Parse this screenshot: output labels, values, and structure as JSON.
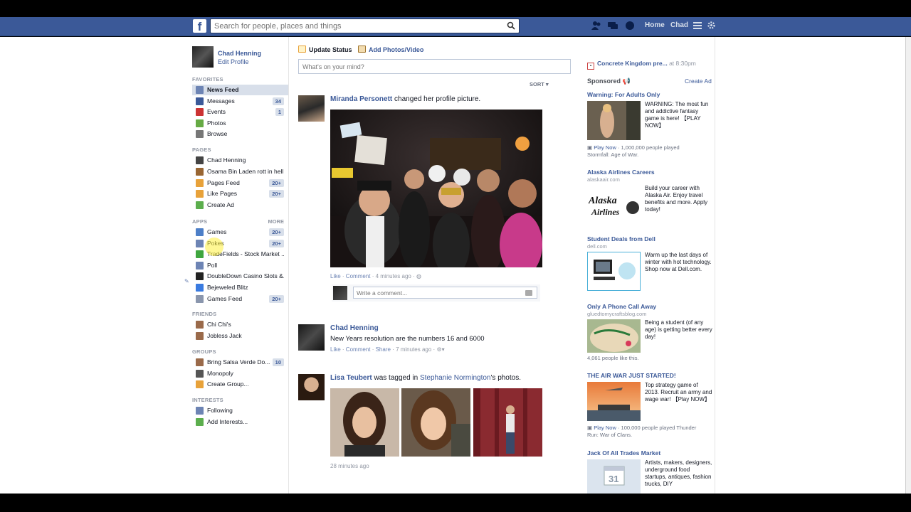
{
  "topbar": {
    "search_placeholder": "Search for people, places and things",
    "home": "Home",
    "user": "Chad"
  },
  "left_nav": {
    "profile_name": "Chad Henning",
    "edit_profile": "Edit Profile",
    "favorites_header": "FAVORITES",
    "favorites": [
      {
        "label": "News Feed",
        "count": "",
        "color": "#6d84b4"
      },
      {
        "label": "Messages",
        "count": "34",
        "color": "#3b5998"
      },
      {
        "label": "Events",
        "count": "1",
        "color": "#cc3333"
      },
      {
        "label": "Photos",
        "count": "",
        "color": "#66aa44"
      },
      {
        "label": "Browse",
        "count": "",
        "color": "#777777"
      }
    ],
    "pages_header": "PAGES",
    "pages": [
      {
        "label": "Chad Henning",
        "count": "",
        "color": "#444444"
      },
      {
        "label": "Osama Bin Laden rott in hell",
        "count": "",
        "color": "#996633"
      },
      {
        "label": "Pages Feed",
        "count": "20+",
        "color": "#e8a23a"
      },
      {
        "label": "Like Pages",
        "count": "20+",
        "color": "#e8a23a"
      },
      {
        "label": "Create Ad",
        "count": "",
        "color": "#5cae4d"
      }
    ],
    "apps_header": "APPS",
    "apps_more": "MORE",
    "apps": [
      {
        "label": "Games",
        "count": "20+",
        "color": "#4d7fc8"
      },
      {
        "label": "Pokes",
        "count": "20+",
        "color": "#6d84b4"
      },
      {
        "label": "TradeFields - Stock Market ...",
        "count": "",
        "color": "#3fa63f"
      },
      {
        "label": "Poll",
        "count": "",
        "color": "#6d84b4"
      },
      {
        "label": "DoubleDown Casino Slots &...",
        "count": "",
        "color": "#222222"
      },
      {
        "label": "Bejeweled Blitz",
        "count": "",
        "color": "#3a7be0"
      },
      {
        "label": "Games Feed",
        "count": "20+",
        "color": "#8a96ad"
      }
    ],
    "friends_header": "FRIENDS",
    "friends": [
      {
        "label": "Chi Chi's",
        "count": "",
        "color": "#9a6a4a"
      },
      {
        "label": "Jobless Jack",
        "count": "",
        "color": "#9a6a4a"
      }
    ],
    "groups_header": "GROUPS",
    "groups": [
      {
        "label": "Bring Salsa Verde Do...",
        "count": "10",
        "color": "#9a6a4a"
      },
      {
        "label": "Monopoly",
        "count": "",
        "color": "#555555"
      },
      {
        "label": "Create Group...",
        "count": "",
        "color": "#e8a23a"
      }
    ],
    "interests_header": "INTERESTS",
    "interests": [
      {
        "label": "Following",
        "count": "",
        "color": "#6d84b4"
      },
      {
        "label": "Add Interests...",
        "count": "",
        "color": "#5cae4d"
      }
    ]
  },
  "composer": {
    "update_status": "Update Status",
    "add_photos": "Add Photos/Video",
    "placeholder": "What's on your mind?",
    "sort": "SORT"
  },
  "feed": {
    "story1": {
      "name": "Miranda Personett",
      "action": " changed her profile picture.",
      "meta_like": "Like",
      "meta_comment": "Comment",
      "meta_time": "4 minutes ago",
      "comment_placeholder": "Write a comment..."
    },
    "story2": {
      "name": "Chad Henning",
      "body": "New Years resolution are the numbers 16 and 6000",
      "meta_like": "Like",
      "meta_comment": "Comment",
      "meta_share": "Share",
      "meta_time": "7 minutes ago"
    },
    "story3": {
      "name": "Lisa Teubert",
      "action": " was tagged in ",
      "tagger": "Stephanie Normington",
      "action2": "'s photos.",
      "meta_time": "28 minutes ago"
    }
  },
  "right_col": {
    "event_title": "Concrete Kingdom pre...",
    "event_time": " at 8:30pm",
    "sponsored": "Sponsored",
    "create_ad": "Create Ad",
    "ads": [
      {
        "title": "Warning: For Adults Only",
        "url": "",
        "body": "WARNING: The most fun and addictive fantasy game is here! 【PLAY NOW】",
        "social_link": "Play Now",
        "social_text": " · 1,000,000 people played",
        "social_text2": "Stormfall: Age of War."
      },
      {
        "title": "Alaska Airlines Careers",
        "url": "alaskaair.com",
        "body": "Build your career with Alaska Air. Enjoy travel benefits and more. Apply today!"
      },
      {
        "title": "Student Deals from Dell",
        "url": "dell.com",
        "body": "Warm up the last days of winter with hot technology. Shop now at Dell.com."
      },
      {
        "title": "Only A Phone Call Away",
        "url": "gluedtomycraftsblog.com",
        "body": "Being a student (of any age) is getting better every day!",
        "social_text": "4,061 people like this."
      },
      {
        "title": "THE AIR WAR JUST STARTED!",
        "url": "",
        "body": "Top strategy game of 2013. Recruit an army and wage war! 【Play NOW】",
        "social_link": "Play Now",
        "social_text": " · 100,000 people played Thunder",
        "social_text2": "Run: War of Clans."
      },
      {
        "title": "Jack Of All Trades Market",
        "url": "",
        "body": "Artists, makers, designers, underground food startups, antiques, fashion trucks, DIY"
      }
    ]
  }
}
